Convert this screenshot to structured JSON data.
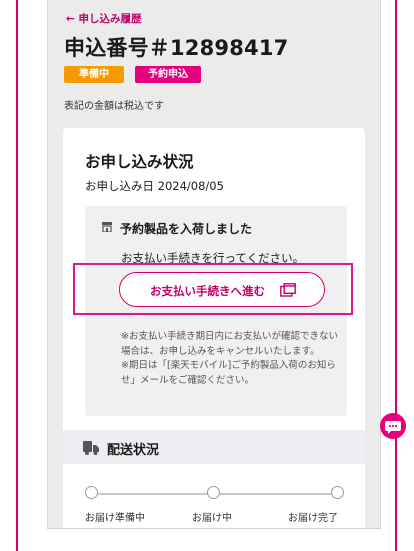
{
  "order": {
    "back_link": "← 申し込み履歴",
    "title": "申込番号＃12898417",
    "badge_prep": "準備中",
    "badge_reservation": "予約申込",
    "tax_note": "表記の金額は税込です"
  },
  "status_card": {
    "title": "お申し込み状況",
    "date": "お申し込み日 2024/08/05",
    "arrival_heading": "予約製品を入荷しました",
    "payment_message": "お支払い手続きを行ってください。",
    "payment_button_label": "お支払い手続きへ進む",
    "notes": "※お支払い手続き期日内にお支払いが確認できない場合は、お申し込みをキャンセルいたします。\n※期日は「[楽天モバイル]ご予約製品入荷のお知らせ」メールをご確認ください。"
  },
  "shipping": {
    "title": "配送状況",
    "steps": [
      "お届け準備中",
      "お届け中",
      "お届け完了"
    ]
  },
  "colors": {
    "accent": "#e6007e",
    "badge_prep": "#f59a00",
    "badge_reservation": "#e6007e"
  },
  "icons": {
    "store": "store-icon",
    "open_window": "open-window-icon",
    "truck": "truck-icon",
    "chat": "chat-icon"
  }
}
